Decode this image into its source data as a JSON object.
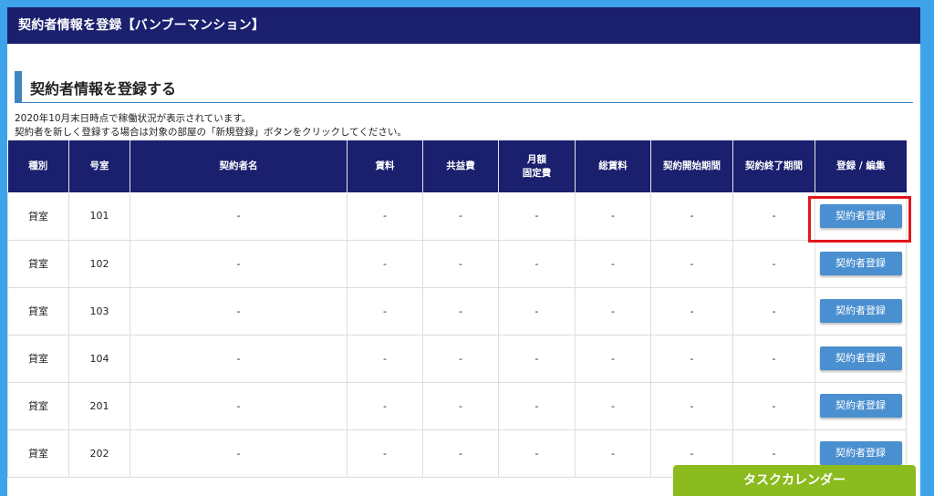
{
  "window": {
    "title": "契約者情報を登録【バンブーマンション】"
  },
  "page": {
    "heading": "契約者情報を登録する",
    "note_line1": "2020年10月末日時点で稼働状況が表示されています。",
    "note_line2": "契約者を新しく登録する場合は対象の部屋の「新規登録」ボタンをクリックしてください。"
  },
  "table": {
    "headers": {
      "type": "種別",
      "room": "号室",
      "contractor": "契約者名",
      "rent": "賃料",
      "common_fee": "共益費",
      "monthly_fixed_line1": "月額",
      "monthly_fixed_line2": "固定費",
      "total_rent": "総賃料",
      "start_period": "契約開始期間",
      "end_period": "契約終了期間",
      "action": "登録 / 編集"
    },
    "rows": [
      {
        "type": "貸室",
        "room": "101",
        "contractor": "-",
        "rent": "-",
        "common_fee": "-",
        "monthly_fixed": "-",
        "total_rent": "-",
        "start": "-",
        "end": "-",
        "button": "契約者登録"
      },
      {
        "type": "貸室",
        "room": "102",
        "contractor": "-",
        "rent": "-",
        "common_fee": "-",
        "monthly_fixed": "-",
        "total_rent": "-",
        "start": "-",
        "end": "-",
        "button": "契約者登録"
      },
      {
        "type": "貸室",
        "room": "103",
        "contractor": "-",
        "rent": "-",
        "common_fee": "-",
        "monthly_fixed": "-",
        "total_rent": "-",
        "start": "-",
        "end": "-",
        "button": "契約者登録"
      },
      {
        "type": "貸室",
        "room": "104",
        "contractor": "-",
        "rent": "-",
        "common_fee": "-",
        "monthly_fixed": "-",
        "total_rent": "-",
        "start": "-",
        "end": "-",
        "button": "契約者登録"
      },
      {
        "type": "貸室",
        "room": "201",
        "contractor": "-",
        "rent": "-",
        "common_fee": "-",
        "monthly_fixed": "-",
        "total_rent": "-",
        "start": "-",
        "end": "-",
        "button": "契約者登録"
      },
      {
        "type": "貸室",
        "room": "202",
        "contractor": "-",
        "rent": "-",
        "common_fee": "-",
        "monthly_fixed": "-",
        "total_rent": "-",
        "start": "-",
        "end": "-",
        "button": "契約者登録"
      }
    ]
  },
  "task_calendar": {
    "label": "タスクカレンダー"
  },
  "colors": {
    "header_navy": "#1a1f6e",
    "accent_blue": "#3f86c4",
    "button_blue": "#4a8fd0",
    "highlight_red": "#e3161b",
    "task_green": "#8bbb1f",
    "background_blue": "#3ea3ea"
  }
}
